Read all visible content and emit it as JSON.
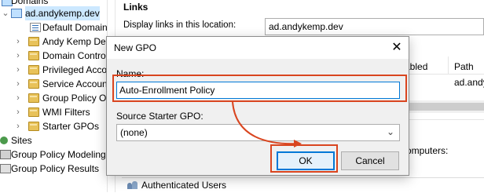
{
  "tree": {
    "partial_top_label": "Domains",
    "domain_label": "ad.andykemp.dev",
    "items": [
      {
        "label": "Default Domain",
        "icon": "gpo-link-icon"
      },
      {
        "label": "Andy Kemp Dev",
        "icon": "ou-folder-icon"
      },
      {
        "label": "Domain Contro",
        "icon": "ou-folder-icon"
      },
      {
        "label": "Privileged Acco",
        "icon": "ou-folder-icon"
      },
      {
        "label": "Service Accoun",
        "icon": "ou-folder-icon"
      },
      {
        "label": "Group Policy Ob",
        "icon": "gpo-folder-icon"
      },
      {
        "label": "WMI Filters",
        "icon": "wmi-folder-icon"
      },
      {
        "label": "Starter GPOs",
        "icon": "starter-gpo-folder-icon"
      }
    ],
    "sites_label": "Sites",
    "modeling_label": "Group Policy Modeling",
    "results_label": "Group Policy Results"
  },
  "links_panel": {
    "title": "Links",
    "description": "Display links in this location:",
    "location_value": "ad.andykemp.dev",
    "col_enabled": "abled",
    "col_path": "Path",
    "path_value": "ad.andy",
    "computers_label": "omputers:",
    "security_item": "Authenticated Users"
  },
  "dialog": {
    "title": "New GPO",
    "close_symbol": "✕",
    "name_label": "Name:",
    "name_value": "Auto-Enrollment Policy",
    "starter_label": "Source Starter GPO:",
    "starter_value": "(none)",
    "ok_label": "OK",
    "cancel_label": "Cancel"
  },
  "colors": {
    "highlight": "#d9451f",
    "focus": "#0078d7",
    "selection": "#cce8ff"
  }
}
